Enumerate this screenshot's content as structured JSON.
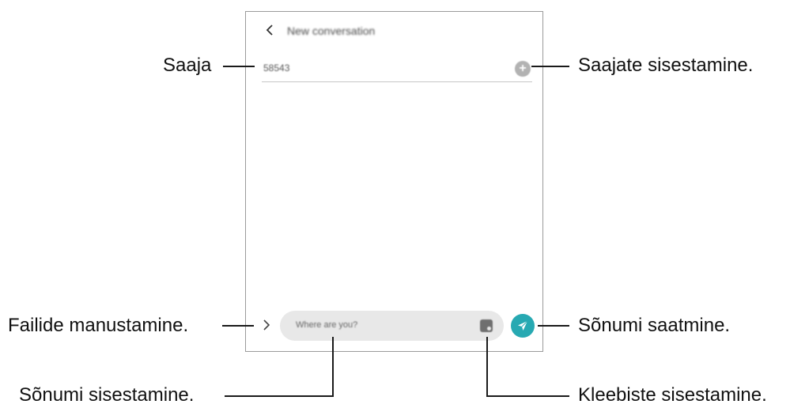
{
  "screen": {
    "header": {
      "title": "New conversation",
      "back_icon": "chevron-left-icon"
    },
    "recipient": {
      "value": "58543",
      "add_icon": "plus-circle-icon"
    },
    "composer": {
      "expand_icon": "chevron-right-icon",
      "placeholder": "Where are you?",
      "sticker_icon": "sticker-icon",
      "send_icon": "send-icon"
    }
  },
  "callouts": {
    "recipient": "Saaja",
    "add_recipients": "Saajate sisestamine.",
    "attach_files": "Failide manustamine.",
    "send_message": "Sõnumi saatmine.",
    "enter_message": "Sõnumi sisestamine.",
    "enter_stickers": "Kleebiste sisestamine."
  },
  "colors": {
    "send_button": "#27a9b2",
    "composer_background": "#e8e8e8",
    "frame_border": "#9a9a9a"
  }
}
